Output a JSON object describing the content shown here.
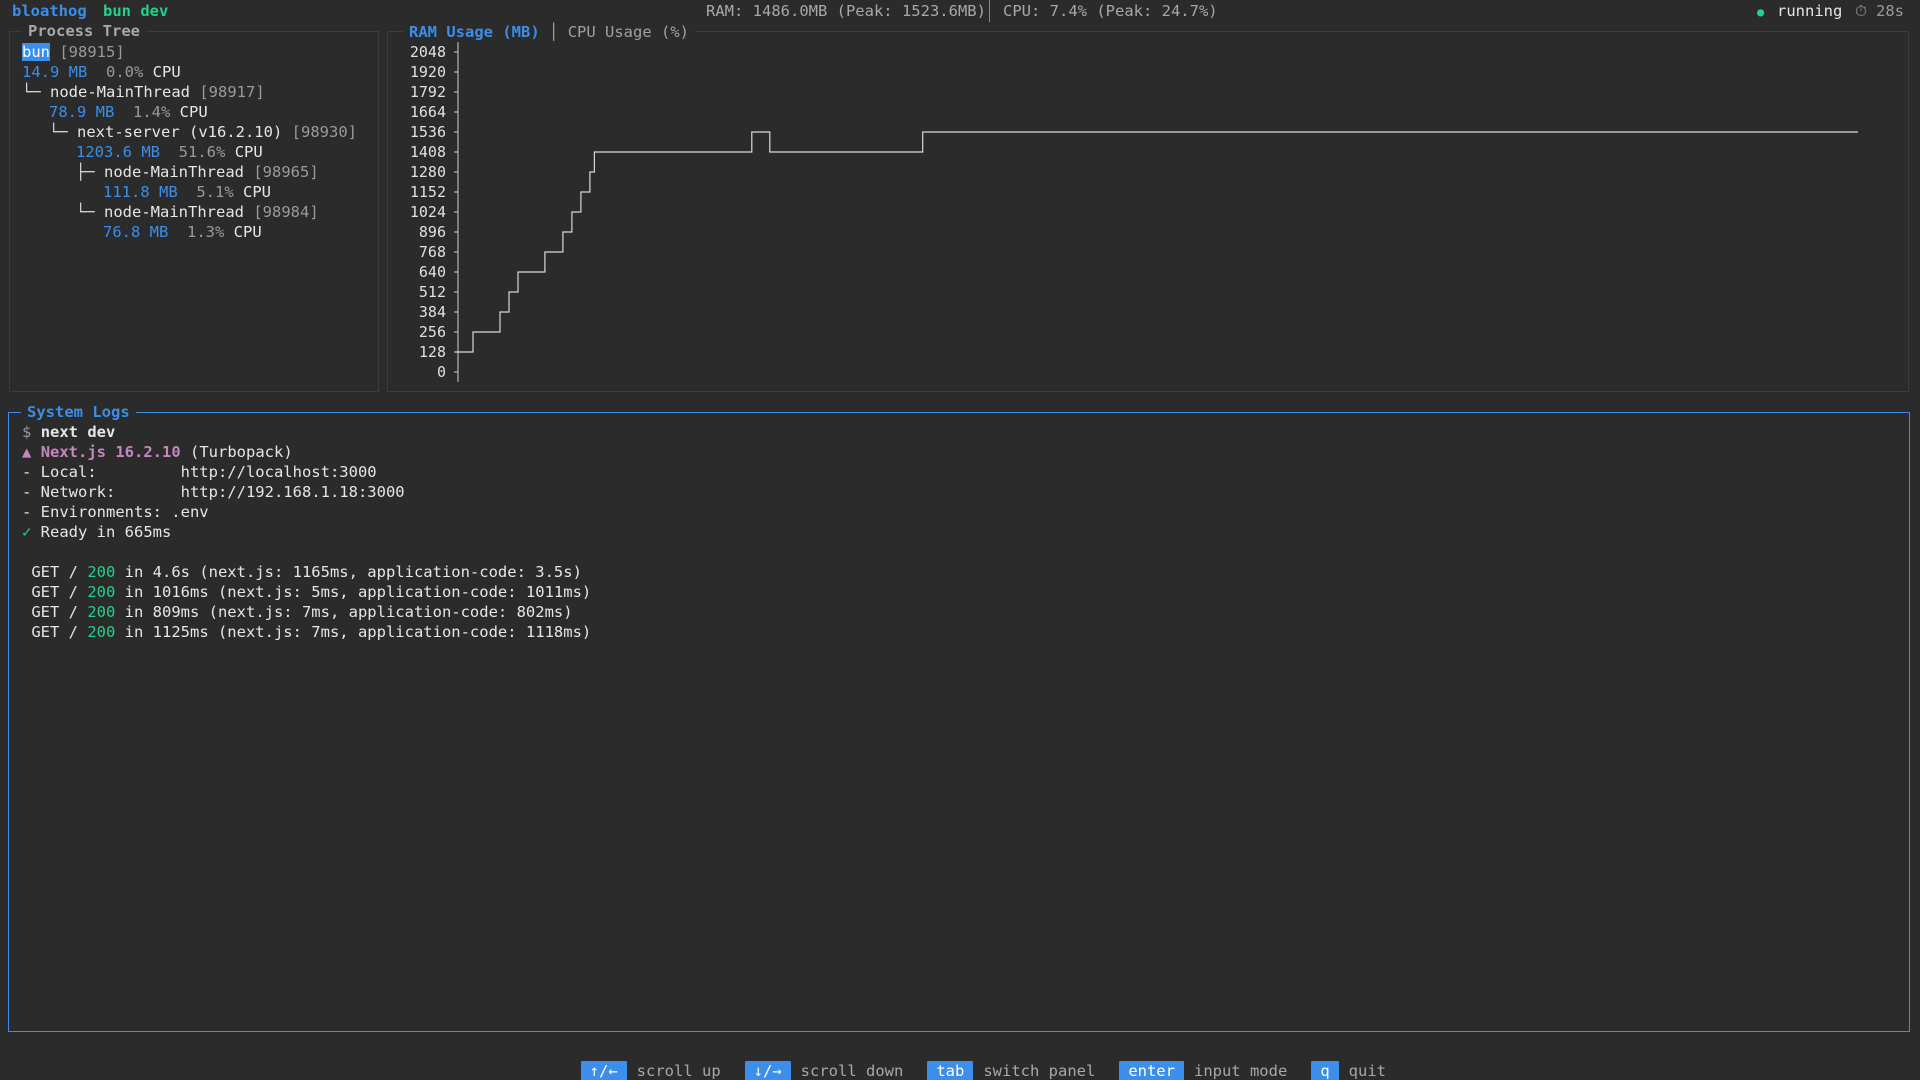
{
  "header": {
    "app_name": "bloathog",
    "command": "bun dev",
    "ram_stat": "RAM: 1486.0MB (Peak: 1523.6MB)",
    "cpu_stat": "CPU: 7.4% (Peak: 24.7%)",
    "status_dot": "●",
    "status": "running",
    "timer_icon": "⏱",
    "elapsed": "28s"
  },
  "process_tree": {
    "title": "Process Tree",
    "nodes": [
      {
        "prefix": "",
        "name": "bun",
        "pid": "[98915]",
        "mem": "14.9 MB",
        "cpu": "0.0%",
        "cpu_label": "CPU",
        "selected": true
      },
      {
        "prefix": "└─ ",
        "name": "node-MainThread",
        "pid": "[98917]",
        "mem": "78.9 MB",
        "cpu": "1.4%",
        "cpu_label": "CPU"
      },
      {
        "prefix": "└─ ",
        "name": "next-server (v16.2.10)",
        "pid": "[98930]",
        "mem": "1203.6 MB",
        "cpu": "51.6%",
        "cpu_label": "CPU"
      },
      {
        "prefix": "├─ ",
        "name": "node-MainThread",
        "pid": "[98965]",
        "mem": "111.8 MB",
        "cpu": "5.1%",
        "cpu_label": "CPU"
      },
      {
        "prefix": "└─ ",
        "name": "node-MainThread",
        "pid": "[98984]",
        "mem": "76.8 MB",
        "cpu": "1.3%",
        "cpu_label": "CPU"
      }
    ]
  },
  "chart_tabs": {
    "ram_tab": "RAM Usage (MB)",
    "separator": "│",
    "cpu_tab": "CPU Usage (%)"
  },
  "chart_data": {
    "type": "line",
    "title": "RAM Usage (MB)",
    "ylabel": "",
    "xlabel": "",
    "ylim": [
      0,
      2048
    ],
    "yticks": [
      "2048",
      "1920",
      "1792",
      "1664",
      "1536",
      "1408",
      "1280",
      "1152",
      "1024",
      "896",
      "768",
      "640",
      "512",
      "384",
      "256",
      "128",
      "0"
    ],
    "grid": false,
    "series": [
      {
        "values": [
          [
            0,
            128
          ],
          [
            2,
            128
          ],
          [
            2,
            256
          ],
          [
            5,
            256
          ],
          [
            5,
            384
          ],
          [
            6,
            384
          ],
          [
            6,
            512
          ],
          [
            7,
            512
          ],
          [
            7,
            640
          ],
          [
            10,
            640
          ],
          [
            10,
            768
          ],
          [
            12,
            768
          ],
          [
            12,
            896
          ],
          [
            13,
            896
          ],
          [
            13,
            1024
          ],
          [
            14,
            1024
          ],
          [
            14,
            1152
          ],
          [
            15,
            1152
          ],
          [
            15,
            1280
          ],
          [
            15.5,
            1280
          ],
          [
            15.5,
            1408
          ],
          [
            33,
            1408
          ],
          [
            33,
            1536
          ],
          [
            35,
            1536
          ],
          [
            35,
            1408
          ],
          [
            52,
            1408
          ],
          [
            52,
            1536
          ],
          [
            156,
            1536
          ]
        ]
      }
    ]
  },
  "logs": {
    "title": "System Logs",
    "prompt": "$",
    "command": "next dev",
    "next_icon": "▲",
    "next_version": "Next.js 16.2.10",
    "next_extra": " (Turbopack)",
    "local_label": "- Local:         ",
    "local_url": "http://localhost:3000",
    "network_label": "- Network:       ",
    "network_url": "http://192.168.1.18:3000",
    "env_line": "- Environments: .env",
    "check_icon": "✓",
    "ready_text": " Ready in 665ms",
    "requests": [
      {
        "method": " GET / ",
        "status": "200",
        "rest": " in 4.6s (next.js: 1165ms, application-code: 3.5s)"
      },
      {
        "method": " GET / ",
        "status": "200",
        "rest": " in 1016ms (next.js: 5ms, application-code: 1011ms)"
      },
      {
        "method": " GET / ",
        "status": "200",
        "rest": " in 809ms (next.js: 7ms, application-code: 802ms)"
      },
      {
        "method": " GET / ",
        "status": "200",
        "rest": " in 1125ms (next.js: 7ms, application-code: 1118ms)"
      }
    ]
  },
  "footer": {
    "keys": [
      {
        "key": "↑/←",
        "label": "scroll up"
      },
      {
        "key": "↓/→",
        "label": "scroll down"
      },
      {
        "key": "tab",
        "label": "switch panel"
      },
      {
        "key": "enter",
        "label": "input mode"
      },
      {
        "key": "q",
        "label": "quit"
      }
    ]
  }
}
